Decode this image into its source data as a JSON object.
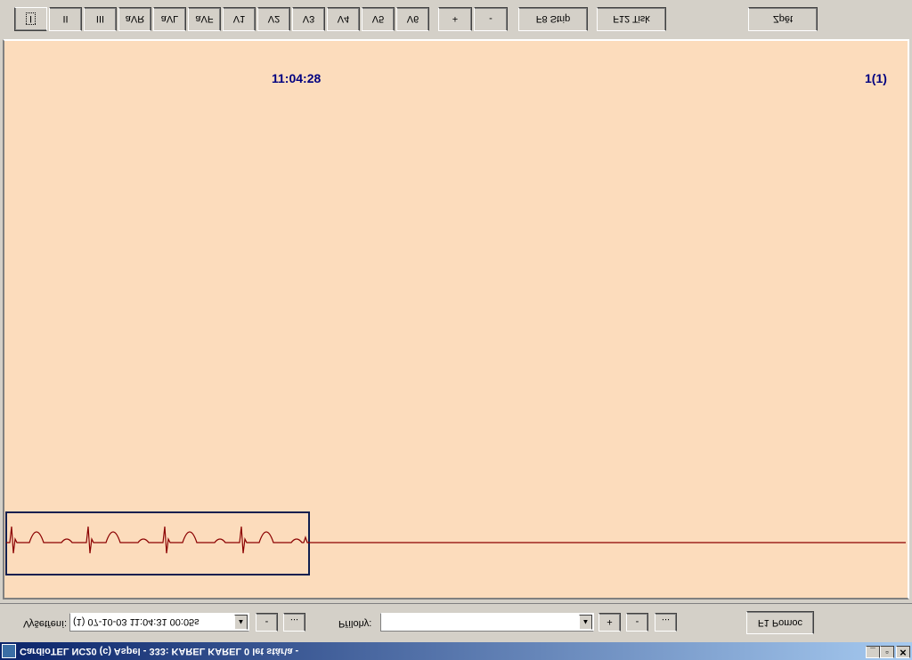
{
  "window": {
    "title": "CardioTEL NC20 (c) Aspel - 333: KAREL KAREL 0 let stár\\a -",
    "minimize_glyph": "_",
    "maximize_glyph": "▫",
    "close_glyph": "✕"
  },
  "filter_bar": {
    "exam_label": "Vyšetření:",
    "exam_value": "(1) 07-10-03  11:04:31  00:05s",
    "exam_minus": "-",
    "exam_more": "...",
    "appendix_label": "Přílohy:",
    "appendix_value": "",
    "appendix_plus": "+",
    "appendix_minus": "-",
    "appendix_more": "...",
    "help_label": "F1 Pomoc",
    "combo_arrow": "▲"
  },
  "display": {
    "time": "11:04:28",
    "page": "1(1)",
    "background_color": "#fcdcbc",
    "trace_color": "#8b0000",
    "readout_color": "#000080"
  },
  "toolbar": {
    "leads": [
      "I",
      "II",
      "III",
      "aVR",
      "aVL",
      "aVF",
      "V1",
      "V2",
      "V3",
      "V4",
      "V5",
      "V6"
    ],
    "selected_lead": "I",
    "plus": "+",
    "minus": "-",
    "strip_label": "F8 Strip",
    "print_label": "F12 Tisk",
    "back_label": "Zpět"
  }
}
